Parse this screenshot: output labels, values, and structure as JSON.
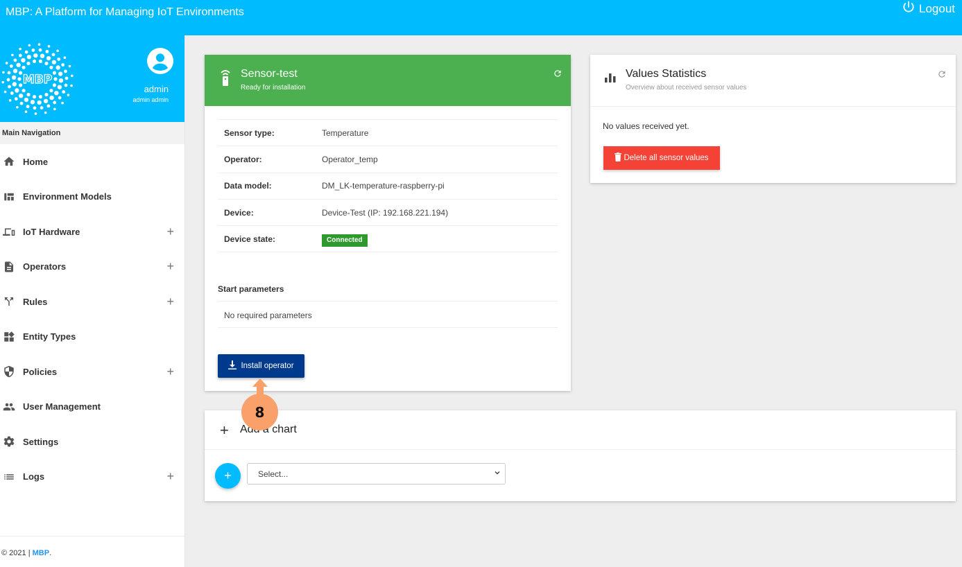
{
  "app": {
    "title": "MBP: A Platform for Managing IoT Environments",
    "logout_label": "Logout"
  },
  "colors": {
    "primary": "#00bcff",
    "success": "#4caf50",
    "install": "#003a8c",
    "danger": "#f44336",
    "annotation": "#f9a06b"
  },
  "sidebar": {
    "logo_text": "MBP",
    "user": {
      "name": "admin",
      "full_name": "admin admin"
    },
    "nav_title": "Main Navigation",
    "items": [
      {
        "label": "Home",
        "icon": "home-icon",
        "expandable": false
      },
      {
        "label": "Environment Models",
        "icon": "dashboard-icon",
        "expandable": false
      },
      {
        "label": "IoT Hardware",
        "icon": "devices-icon",
        "expandable": true
      },
      {
        "label": "Operators",
        "icon": "document-icon",
        "expandable": true
      },
      {
        "label": "Rules",
        "icon": "call-split-icon",
        "expandable": true
      },
      {
        "label": "Entity Types",
        "icon": "widgets-icon",
        "expandable": false
      },
      {
        "label": "Policies",
        "icon": "shield-icon",
        "expandable": true
      },
      {
        "label": "User Management",
        "icon": "people-icon",
        "expandable": false
      },
      {
        "label": "Settings",
        "icon": "gear-icon",
        "expandable": false
      },
      {
        "label": "Logs",
        "icon": "list-icon",
        "expandable": true
      }
    ],
    "expand_symbol": "+",
    "footer": {
      "copyright": "© 2021 | ",
      "brand": "MBP",
      "suffix": "."
    }
  },
  "sensor_card": {
    "title": "Sensor-test",
    "subtitle": "Ready for installation",
    "rows": [
      {
        "key": "Sensor type:",
        "value": "Temperature"
      },
      {
        "key": "Operator:",
        "value": "Operator_temp"
      },
      {
        "key": "Data model:",
        "value": "DM_LK-temperature-raspberry-pi"
      },
      {
        "key": "Device:",
        "value": "Device-Test (IP: 192.168.221.194)"
      },
      {
        "key": "Device state:",
        "value": "Connected"
      }
    ],
    "start_parameters_title": "Start parameters",
    "start_parameters_text": "No required parameters",
    "install_label": "Install operator"
  },
  "stats_card": {
    "title": "Values Statistics",
    "subtitle": "Overview about received sensor values",
    "empty_text": "No values received yet.",
    "delete_label": "Delete all sensor values"
  },
  "chart_card": {
    "title": "Add a chart",
    "add_symbol": "+",
    "select_placeholder": "Select..."
  },
  "annotation": {
    "step": "8"
  }
}
